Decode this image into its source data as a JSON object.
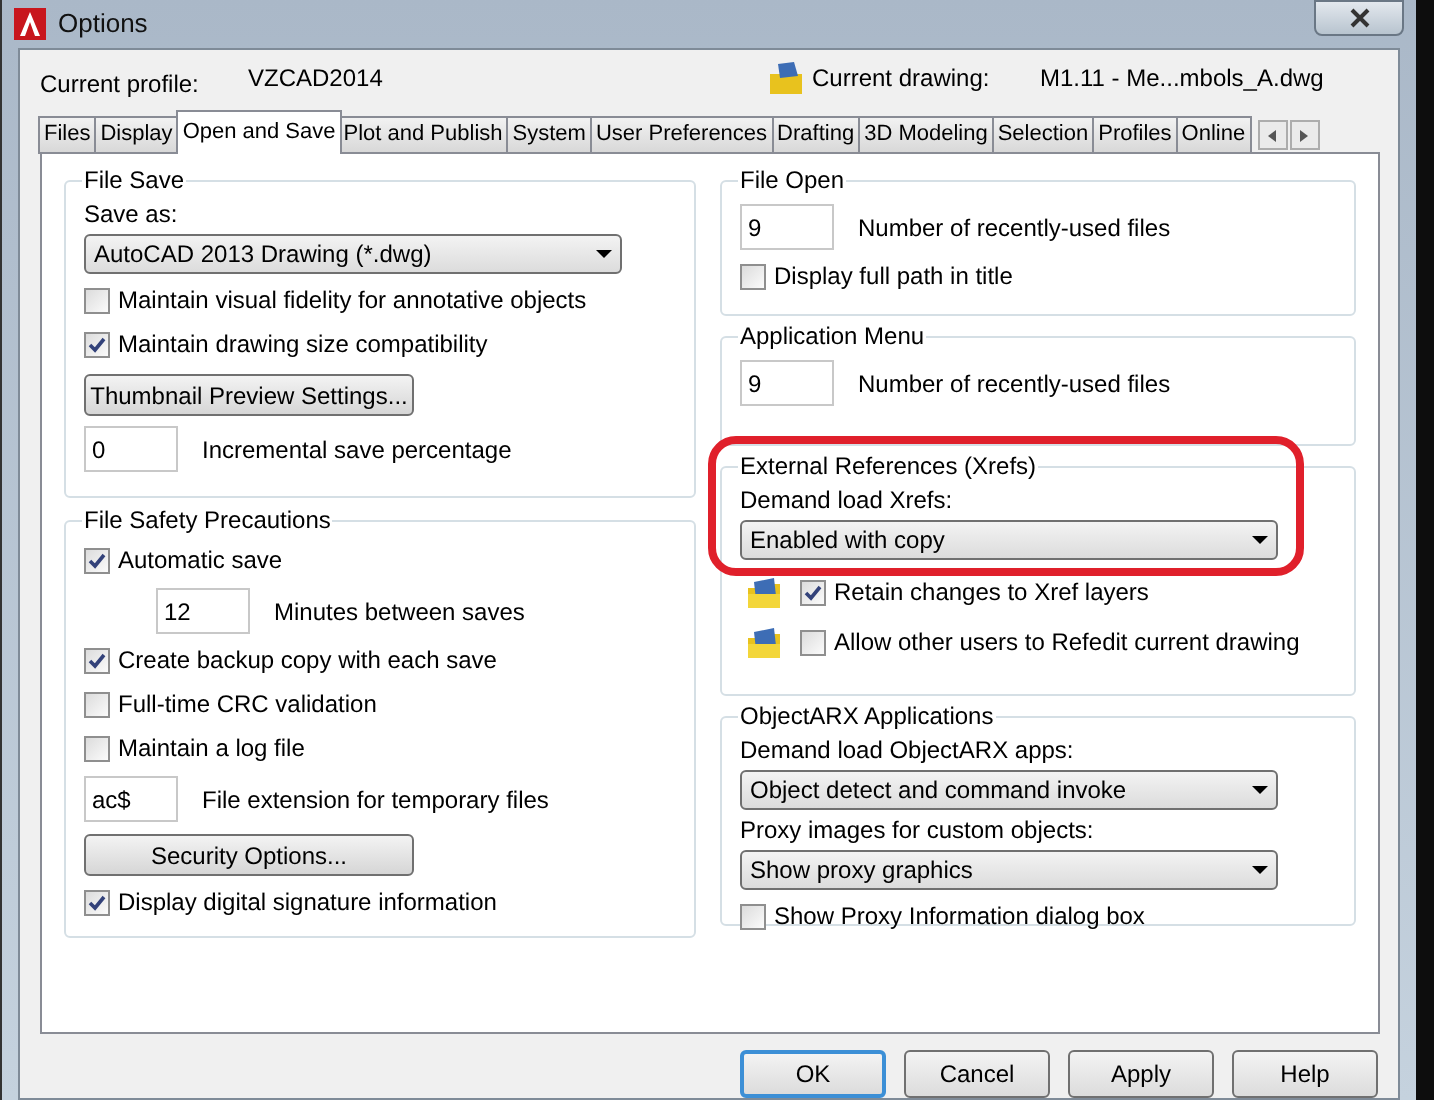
{
  "window": {
    "title": "Options"
  },
  "profile": {
    "label": "Current profile:",
    "value": "VZCAD2014"
  },
  "drawing": {
    "label": "Current drawing:",
    "value": "M1.11 - Me...mbols_A.dwg"
  },
  "tabs": [
    {
      "label": "Files",
      "selected": false
    },
    {
      "label": "Display",
      "selected": false
    },
    {
      "label": "Open and Save",
      "selected": true
    },
    {
      "label": "Plot and Publish",
      "selected": false
    },
    {
      "label": "System",
      "selected": false
    },
    {
      "label": "User Preferences",
      "selected": false
    },
    {
      "label": "Drafting",
      "selected": false
    },
    {
      "label": "3D Modeling",
      "selected": false
    },
    {
      "label": "Selection",
      "selected": false
    },
    {
      "label": "Profiles",
      "selected": false
    },
    {
      "label": "Online",
      "selected": false
    }
  ],
  "left_column": [
    {
      "title": "File Save",
      "highlighted": false,
      "items": [
        {
          "kind": "label",
          "text": "Save as:"
        },
        {
          "kind": "dropdown",
          "value": "AutoCAD 2013 Drawing (*.dwg)"
        },
        {
          "kind": "checkbox",
          "label": "Maintain visual fidelity for annotative objects",
          "checked": false
        },
        {
          "kind": "checkbox",
          "label": "Maintain drawing size compatibility",
          "checked": true
        },
        {
          "kind": "button",
          "label": "Thumbnail Preview Settings..."
        },
        {
          "kind": "field",
          "value": "0",
          "text": "Incremental save percentage"
        }
      ]
    },
    {
      "title": "File Safety Precautions",
      "highlighted": false,
      "items": [
        {
          "kind": "checkbox",
          "label": "Automatic save",
          "checked": true
        },
        {
          "kind": "indented-field",
          "value": "12",
          "text": "Minutes between saves"
        },
        {
          "kind": "checkbox",
          "label": "Create backup copy with each save",
          "checked": true
        },
        {
          "kind": "checkbox",
          "label": "Full-time CRC validation",
          "checked": false
        },
        {
          "kind": "checkbox",
          "label": "Maintain a log file",
          "checked": false
        },
        {
          "kind": "field",
          "value": "ac$",
          "text": "File extension for temporary files"
        },
        {
          "kind": "button",
          "label": "Security Options..."
        },
        {
          "kind": "checkbox",
          "label": "Display digital signature information",
          "checked": true
        }
      ]
    }
  ],
  "right_column": [
    {
      "title": "File Open",
      "highlighted": false,
      "items": [
        {
          "kind": "field",
          "value": "9",
          "text": "Number of recently-used files"
        },
        {
          "kind": "checkbox",
          "label": "Display full path in title",
          "checked": false
        }
      ]
    },
    {
      "title": "Application Menu",
      "highlighted": false,
      "items": [
        {
          "kind": "field",
          "value": "9",
          "text": "Number of recently-used files"
        }
      ]
    },
    {
      "title": "External References (Xrefs)",
      "highlighted": true,
      "items": [
        {
          "kind": "label",
          "text": "Demand load Xrefs:"
        },
        {
          "kind": "dropdown",
          "value": "Enabled with copy"
        },
        {
          "kind": "icon-checkbox",
          "label": "Retain changes to Xref layers",
          "checked": true
        },
        {
          "kind": "icon-checkbox",
          "label": "Allow other users to Refedit current drawing",
          "checked": false
        }
      ]
    },
    {
      "title": "ObjectARX Applications",
      "highlighted": false,
      "items": [
        {
          "kind": "label",
          "text": "Demand load ObjectARX apps:"
        },
        {
          "kind": "dropdown",
          "value": "Object detect and command invoke"
        },
        {
          "kind": "label",
          "text": "Proxy images for custom objects:"
        },
        {
          "kind": "dropdown",
          "value": "Show proxy graphics"
        },
        {
          "kind": "checkbox",
          "label": "Show Proxy Information dialog box",
          "checked": false
        }
      ]
    }
  ],
  "buttons": [
    {
      "label": "OK",
      "default": true
    },
    {
      "label": "Cancel",
      "default": false
    },
    {
      "label": "Apply",
      "default": false
    },
    {
      "label": "Help",
      "default": false
    }
  ]
}
